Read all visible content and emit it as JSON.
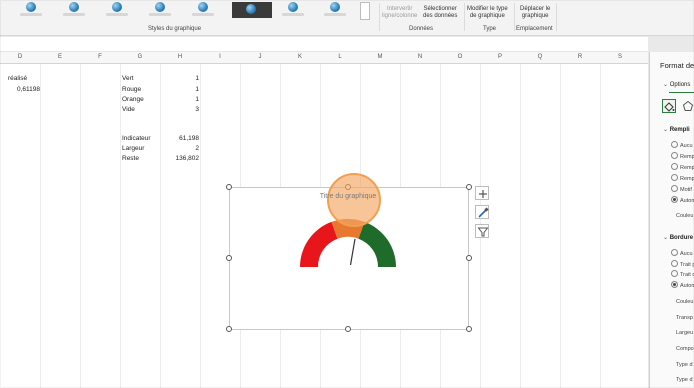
{
  "ribbon": {
    "styles_group_label": "Styles du graphique",
    "data_group_label": "Données",
    "type_group_label": "Type",
    "placement_group_label": "Emplacement",
    "switch_row_col": "Intervertir\nligne/colonne",
    "select_data": "Sélectionner\ndes données",
    "change_type": "Modifier le type\nde graphique",
    "move_chart": "Déplacer le\ngraphique",
    "style_thumbs": [
      "style-1",
      "style-2",
      "style-3",
      "style-4",
      "style-5",
      "style-6",
      "style-7",
      "style-8"
    ]
  },
  "sheet": {
    "columns": [
      "D",
      "E",
      "F",
      "G",
      "H",
      "I",
      "J",
      "K",
      "L",
      "M",
      "N",
      "O",
      "P",
      "Q",
      "R",
      "S"
    ],
    "cells": {
      "d_label": "réalisé",
      "d_value": "0,61198",
      "vert_label": "Vert",
      "vert_value": "1",
      "rouge_label": "Rouge",
      "rouge_value": "1",
      "orange_label": "Orange",
      "orange_value": "1",
      "vide_label": "Vide",
      "vide_value": "3",
      "indicateur_label": "Indicateur",
      "indicateur_value": "61,198",
      "largeur_label": "Largeur",
      "largeur_value": "2",
      "reste_label": "Reste",
      "reste_value": "136,802"
    }
  },
  "chart": {
    "title": "Titre du graphique",
    "colors": {
      "red": "#e8161a",
      "orange": "#e8782f",
      "green": "#1e6b2a",
      "needle": "#333333"
    },
    "side_buttons": [
      "plus-icon",
      "brush-icon",
      "filter-icon"
    ]
  },
  "pane": {
    "title": "Format de",
    "options_tab": "Options",
    "fill_section": "Rempli",
    "fill_options": [
      "Aucu",
      "Remp",
      "Remp",
      "Remp",
      "Motif",
      "Autom"
    ],
    "fill_color_label": "Couleu",
    "border_section": "Bordure",
    "border_options": [
      "Aucu",
      "Trait p",
      "Trait d",
      "Autom"
    ],
    "border_fields": [
      "Couleu",
      "Transp",
      "Largeu",
      "Compo",
      "Type d",
      "Type d"
    ]
  }
}
